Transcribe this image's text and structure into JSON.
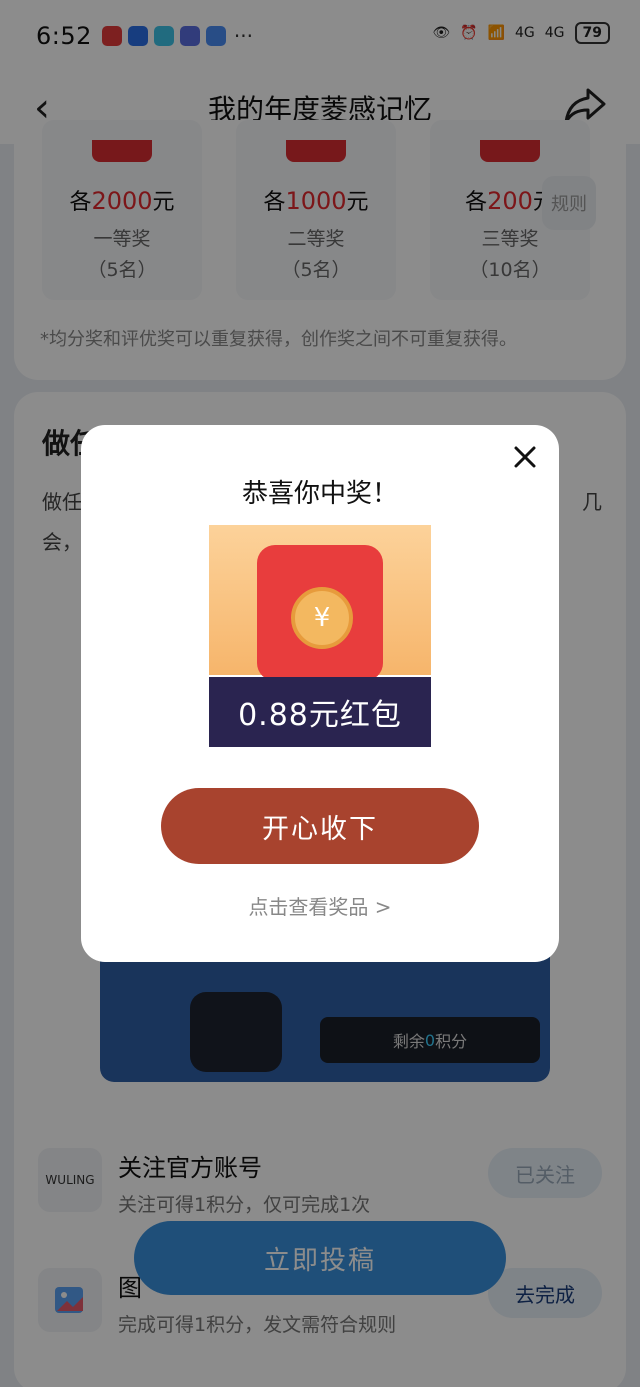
{
  "status_bar": {
    "time": "6:52",
    "battery": "79",
    "network1": "4G",
    "network2": "4G",
    "more": "···"
  },
  "nav": {
    "title": "我的年度菱感记忆"
  },
  "prizes": [
    {
      "prefix": "各",
      "amount": "2000",
      "unit": "元",
      "rank": "一等奖",
      "count": "（5名）"
    },
    {
      "prefix": "各",
      "amount": "1000",
      "unit": "元",
      "rank": "二等奖",
      "count": "（5名）"
    },
    {
      "prefix": "各",
      "amount": "200",
      "unit": "元",
      "rank": "三等奖",
      "count": "（10名）"
    }
  ],
  "rules_button": "规则",
  "note": "*均分奖和评优奖可以重复获得，创作奖之间不可重复获得。",
  "section": {
    "title_visible": "做任",
    "desc_line1_visible": "做任",
    "desc_line1_tail": "几",
    "desc_line2_visible": "会，"
  },
  "machine": {
    "remaining_prefix": "剩余",
    "remaining_value": "0",
    "remaining_suffix": "积分"
  },
  "tasks": [
    {
      "title": "关注官方账号",
      "desc": "关注可得1积分，仅可完成1次",
      "button": "已关注",
      "logo_text": "WULING"
    },
    {
      "title": "图",
      "desc": "完成可得1积分，发文需符合规则",
      "button": "去完成"
    }
  ],
  "submit_button": "立即投稿",
  "modal": {
    "title": "恭喜你中奖！",
    "reward_text": "0.88元红包",
    "coin_symbol": "¥",
    "accept_button": "开心收下",
    "view_link": "点击查看奖品 >"
  },
  "colors": {
    "accent_red": "#e2292f",
    "accept_button": "#a8432e",
    "submit_button": "#3a91dd"
  }
}
